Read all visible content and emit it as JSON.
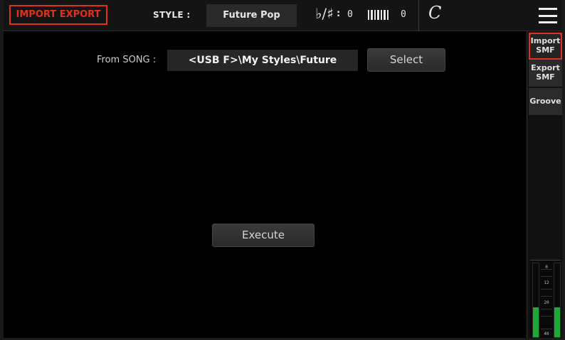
{
  "header": {
    "page_tag": "IMPORT EXPORT",
    "style_label": "STYLE :",
    "style_name": "Future Pop",
    "transpose_icon": "♭/♯",
    "transpose_colon": ":",
    "transpose_value": "0",
    "octave_value": "0",
    "scale_icon": "C",
    "menu_icon": "menu-icon"
  },
  "main": {
    "from_label": "From SONG :",
    "path_value": "<USB F>\\My Styles\\Future",
    "select_label": "Select",
    "execute_label": "Execute"
  },
  "sidebar": {
    "tabs": [
      {
        "line1": "Import",
        "line2": "SMF",
        "active": true
      },
      {
        "line1": "Export",
        "line2": "SMF",
        "active": false
      },
      {
        "line1": "Groove",
        "line2": "",
        "active": false
      }
    ]
  },
  "meter": {
    "ticks": [
      "0",
      "12",
      "20",
      "40"
    ],
    "left_level": 0.4,
    "right_level": 0.4
  },
  "colors": {
    "accent": "#e0301e",
    "meter_green": "#1fa83a",
    "background": "#000000"
  }
}
